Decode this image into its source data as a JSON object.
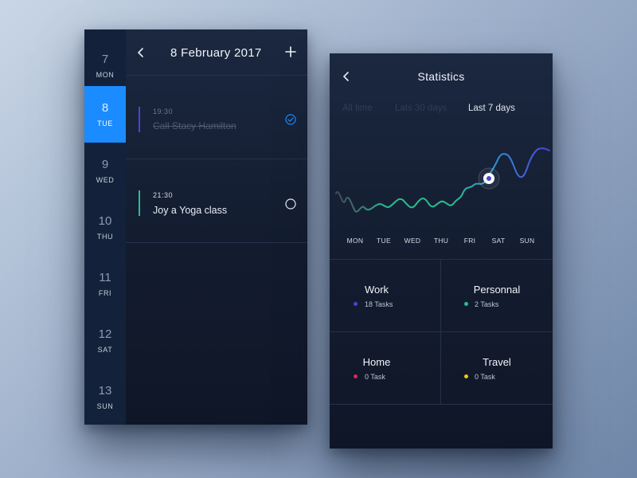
{
  "calendar": {
    "header": {
      "back_icon": "chevron-left-icon",
      "date": "8 February 2017",
      "add_icon": "plus-icon"
    },
    "days": [
      {
        "num": "7",
        "dow": "MON",
        "active": false
      },
      {
        "num": "8",
        "dow": "TUE",
        "active": true
      },
      {
        "num": "9",
        "dow": "WED",
        "active": false
      },
      {
        "num": "10",
        "dow": "THU",
        "active": false
      },
      {
        "num": "11",
        "dow": "FRI",
        "active": false
      },
      {
        "num": "12",
        "dow": "SAT",
        "active": false
      },
      {
        "num": "13",
        "dow": "SUN",
        "active": false
      }
    ],
    "tasks": [
      {
        "time": "19:30",
        "title": "Call Stacy Hamilton",
        "done": true,
        "accent": "#4b43d6"
      },
      {
        "time": "21:30",
        "title": "Joy a Yoga class",
        "done": false,
        "accent": "#2bbd8e"
      }
    ],
    "active_color": "#1a8cff"
  },
  "stats": {
    "header": {
      "back_icon": "chevron-left-icon",
      "title": "Statistics"
    },
    "filters": [
      {
        "label": "All time",
        "selected": false
      },
      {
        "label": "Lats 30 days",
        "selected": false
      },
      {
        "label": "Last 7 days",
        "selected": true
      }
    ],
    "chart_data": {
      "type": "line",
      "categories": [
        "MON",
        "TUE",
        "WED",
        "THU",
        "FRI",
        "SAT",
        "SUN"
      ],
      "highlighted": "SAT",
      "grid": false,
      "gradient": [
        "#2bbd8e",
        "#4b43d6"
      ]
    },
    "categories": [
      {
        "name": "Work",
        "count": "18 Tasks",
        "color": "#4b43d6"
      },
      {
        "name": "Personnal",
        "count": "2 Tasks",
        "color": "#2bbd8e"
      },
      {
        "name": "Home",
        "count": "0 Task",
        "color": "#e0245e"
      },
      {
        "name": "Travel",
        "count": "0 Task",
        "color": "#f5c518"
      }
    ]
  }
}
